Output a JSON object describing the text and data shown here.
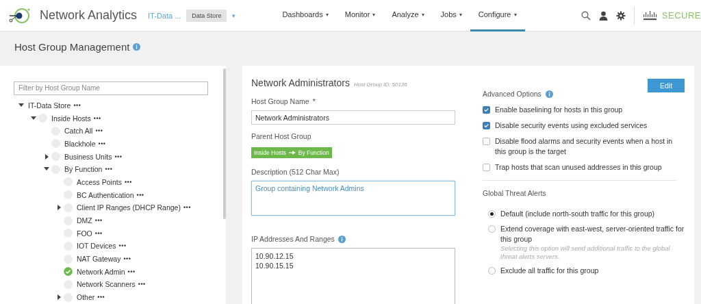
{
  "header": {
    "app_name": "Network Analytics",
    "domain": "IT-Data ...",
    "domain_tag": "Data Store",
    "domain_caret": "▾",
    "nav": [
      {
        "label": "Dashboards",
        "caret": "▾",
        "selected": false
      },
      {
        "label": "Monitor",
        "caret": "▾",
        "selected": false
      },
      {
        "label": "Analyze",
        "caret": "▾",
        "selected": false
      },
      {
        "label": "Jobs",
        "caret": "▾",
        "selected": false
      },
      {
        "label": "Configure",
        "caret": "▾",
        "selected": true
      }
    ],
    "brand": "SECURE"
  },
  "page_title": "Host Group Management",
  "tree": {
    "filter_placeholder": "Filter by Host Group Name",
    "nodes": [
      {
        "label": "IT-Data Store",
        "menu": "•••",
        "expanded": true,
        "children": [
          {
            "label": "Inside Hosts",
            "menu": "•••",
            "expanded": true,
            "selected": false,
            "children": [
              {
                "label": "Catch All",
                "menu": "•••",
                "selected": false
              },
              {
                "label": "Blackhole",
                "menu": "•••",
                "selected": false
              },
              {
                "label": "Business Units",
                "menu": "•••",
                "expanded": false,
                "selected": false
              },
              {
                "label": "By Function",
                "menu": "•••",
                "expanded": true,
                "selected": false,
                "children": [
                  {
                    "label": "Access Points",
                    "menu": "•••",
                    "selected": false
                  },
                  {
                    "label": "BC Authentication",
                    "menu": "•••",
                    "selected": false
                  },
                  {
                    "label": "Client IP Ranges (DHCP Range)",
                    "menu": "•••",
                    "expanded": false,
                    "selected": false
                  },
                  {
                    "label": "DMZ",
                    "menu": "•••",
                    "selected": false
                  },
                  {
                    "label": "FOO",
                    "menu": "•••",
                    "selected": false
                  },
                  {
                    "label": "IOT Devices",
                    "menu": "•••",
                    "selected": false
                  },
                  {
                    "label": "NAT Gateway",
                    "menu": "•••",
                    "selected": false
                  },
                  {
                    "label": "Network Admin",
                    "menu": "•••",
                    "selected": true
                  },
                  {
                    "label": "Network Scanners",
                    "menu": "•••",
                    "selected": false
                  },
                  {
                    "label": "Other",
                    "menu": "•••",
                    "expanded": false,
                    "selected": false
                  }
                ]
              }
            ]
          }
        ]
      }
    ]
  },
  "detail": {
    "title": "Network Administrators",
    "host_group_id": "Host Group ID: 50136",
    "edit_button": "Edit",
    "name_label": "Host Group Name",
    "required_mark": "*",
    "name_value": "Network Administrators",
    "parent_label": "Parent Host Group",
    "parent_path": [
      "Inside Hosts",
      "By Function"
    ],
    "description_label": "Description (512 Char Max)",
    "description_value": "Group containing Network Admins",
    "ip_label": "IP Addresses And Ranges",
    "ip_value": "10.90.12.15\n10.90.15.15",
    "advanced_title": "Advanced Options",
    "options": [
      {
        "label": "Enable baselining for hosts in this group",
        "checked": true
      },
      {
        "label": "Disable security events using excluded services",
        "checked": true
      },
      {
        "label": "Disable flood alarms and security events when a host in this group is the target",
        "checked": false
      },
      {
        "label": "Trap hosts that scan unused addresses in this group",
        "checked": false
      }
    ],
    "threat_title": "Global Threat Alerts",
    "threat_options": [
      {
        "label": "Default (include north-south traffic for this group)",
        "selected": true
      },
      {
        "label": "Extend coverage with east-west, server-oriented traffic for this group",
        "note": "Selecting this option will send additional traffic to the global threat alerts servers.",
        "selected": false
      },
      {
        "label": "Exclude all traffic for this group",
        "selected": false
      }
    ]
  }
}
